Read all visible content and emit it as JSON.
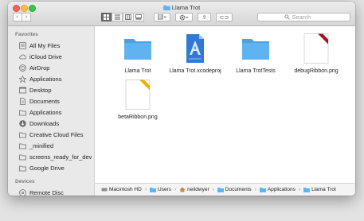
{
  "window": {
    "title": "Llama Trot"
  },
  "toolbar": {
    "back_label": "‹",
    "forward_label": "›",
    "share_label": "⇪",
    "tags_label": "⊂⊃",
    "search_placeholder": "Search"
  },
  "sidebar": {
    "favorites_heading": "Favorites",
    "favorites": [
      {
        "label": "All My Files",
        "icon": "all-files-icon"
      },
      {
        "label": "iCloud Drive",
        "icon": "cloud-icon"
      },
      {
        "label": "AirDrop",
        "icon": "airdrop-icon"
      },
      {
        "label": "Applications",
        "icon": "applications-icon"
      },
      {
        "label": "Desktop",
        "icon": "desktop-icon"
      },
      {
        "label": "Documents",
        "icon": "documents-icon"
      },
      {
        "label": "Applications",
        "icon": "applications-icon"
      },
      {
        "label": "Downloads",
        "icon": "downloads-icon"
      },
      {
        "label": "Creative Cloud Files",
        "icon": "folder-icon"
      },
      {
        "label": "_minified",
        "icon": "folder-icon"
      },
      {
        "label": "screens_ready_for_dev",
        "icon": "folder-icon"
      },
      {
        "label": "Google Drive",
        "icon": "folder-icon"
      }
    ],
    "devices_heading": "Devices",
    "devices": [
      {
        "label": "Remote Disc",
        "icon": "disc-icon"
      }
    ]
  },
  "files": [
    {
      "name": "Llama Trot",
      "kind": "folder"
    },
    {
      "name": "Llama Trot.xcodeproj",
      "kind": "xcodeproj"
    },
    {
      "name": "Llama TrotTests",
      "kind": "folder"
    },
    {
      "name": "debugRibbon.png",
      "kind": "png",
      "ribbon_color": "#a8121e"
    },
    {
      "name": "betaRibbon.png",
      "kind": "png",
      "ribbon_color": "#e7b400"
    }
  ],
  "pathbar": {
    "items": [
      {
        "label": "Macintosh HD",
        "icon": "hard-drive-icon"
      },
      {
        "label": "Users",
        "icon": "folder-icon"
      },
      {
        "label": "neildwyer",
        "icon": "home-icon"
      },
      {
        "label": "Documents",
        "icon": "folder-icon"
      },
      {
        "label": "Applications",
        "icon": "folder-icon"
      },
      {
        "label": "Llama Trot",
        "icon": "folder-icon"
      }
    ],
    "separator": "›"
  },
  "colors": {
    "folder": "#5fb3ee",
    "folder_dark": "#4aa3e0",
    "xcode_blue": "#2f7ad6"
  }
}
